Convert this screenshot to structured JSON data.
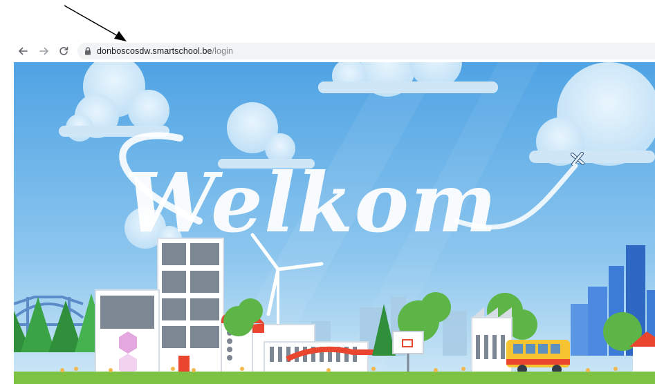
{
  "browser": {
    "url_host": "donboscosdw.smartschool.be",
    "url_path": "/login",
    "back_icon": "arrow-left-icon",
    "forward_icon": "arrow-right-icon",
    "reload_icon": "reload-icon",
    "lock_icon": "lock-icon"
  },
  "hero": {
    "welcome_text": "Welkom",
    "illustration": "city-skyline-illustration"
  },
  "colors": {
    "sky_top": "#4fa3e4",
    "sky_bottom": "#cfe8f6",
    "grass": "#7dc242",
    "bus_yellow": "#f6c431",
    "roof_red": "#e9452f"
  }
}
